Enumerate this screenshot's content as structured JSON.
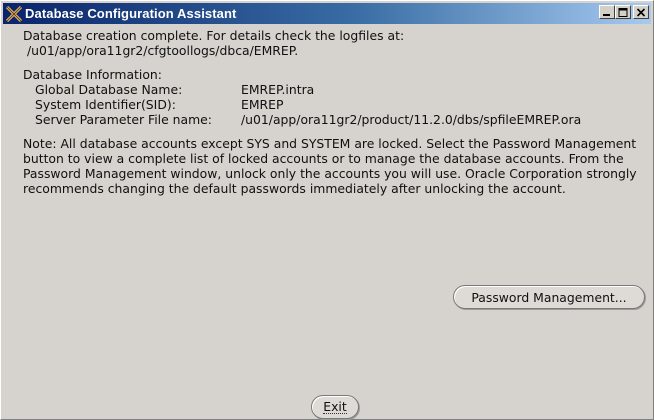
{
  "window": {
    "title": "Database Configuration Assistant",
    "minimize_symbol": "_",
    "maximize_symbol": "□",
    "close_symbol": "X",
    "icon": "oracle-x-icon"
  },
  "message": {
    "line1": "Database creation complete. For details check the logfiles at:",
    "line2": " /u01/app/ora11gr2/cfgtoollogs/dbca/EMREP."
  },
  "info": {
    "heading": "Database Information:",
    "rows": [
      {
        "label": "Global Database Name:",
        "value": "EMREP.intra"
      },
      {
        "label": "System Identifier(SID):",
        "value": "EMREP"
      },
      {
        "label": "Server Parameter File name:",
        "value": "/u01/app/ora11gr2/product/11.2.0/dbs/spfileEMREP.ora"
      }
    ]
  },
  "note": "Note: All database accounts except SYS and SYSTEM are locked. Select the Password Management button to view a complete list of locked accounts or to manage the database accounts. From the Password Management window, unlock only the accounts you will use. Oracle Corporation strongly recommends changing the default passwords immediately after unlocking the account.",
  "buttons": {
    "password_management": "Password Management...",
    "exit": "Exit"
  }
}
